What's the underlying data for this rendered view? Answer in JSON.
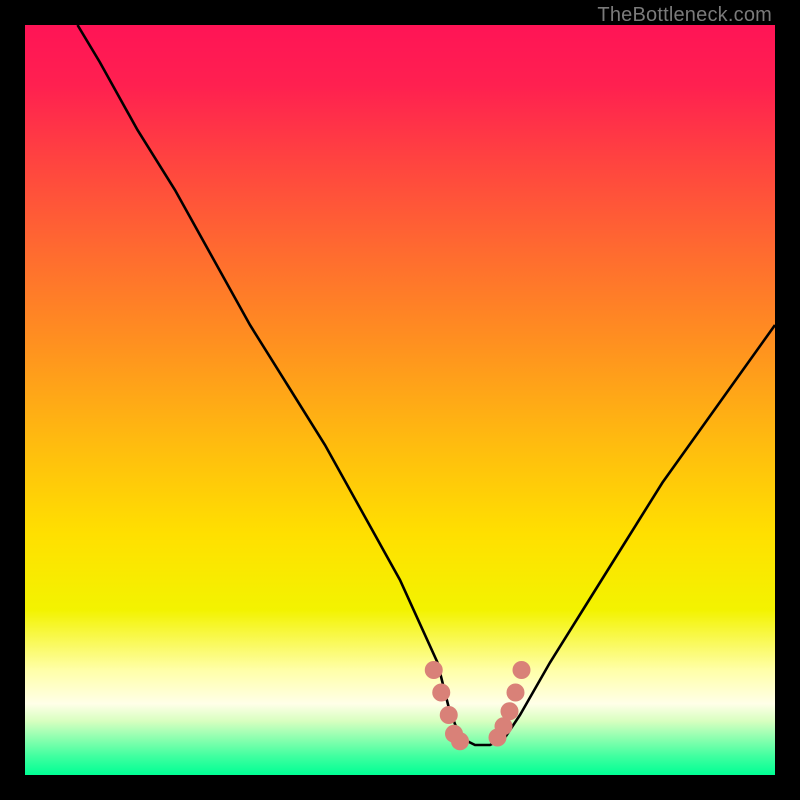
{
  "watermark": "TheBottleneck.com",
  "gradient": {
    "stops": [
      {
        "offset": 0.0,
        "color": "#ff1456"
      },
      {
        "offset": 0.08,
        "color": "#ff2050"
      },
      {
        "offset": 0.18,
        "color": "#ff4340"
      },
      {
        "offset": 0.3,
        "color": "#ff6a30"
      },
      {
        "offset": 0.42,
        "color": "#ff8f20"
      },
      {
        "offset": 0.55,
        "color": "#ffb910"
      },
      {
        "offset": 0.68,
        "color": "#ffe000"
      },
      {
        "offset": 0.78,
        "color": "#f3f300"
      },
      {
        "offset": 0.86,
        "color": "#ffffa8"
      },
      {
        "offset": 0.905,
        "color": "#ffffe8"
      },
      {
        "offset": 0.928,
        "color": "#d8ffc0"
      },
      {
        "offset": 0.95,
        "color": "#90ffb0"
      },
      {
        "offset": 0.975,
        "color": "#40ffa0"
      },
      {
        "offset": 1.0,
        "color": "#00ff94"
      }
    ]
  },
  "chart_data": {
    "type": "line",
    "title": "",
    "xlabel": "",
    "ylabel": "",
    "xlim": [
      0,
      100
    ],
    "ylim": [
      0,
      100
    ],
    "series": [
      {
        "name": "bottleneck-curve",
        "x": [
          7,
          10,
          15,
          20,
          25,
          30,
          35,
          40,
          45,
          50,
          55,
          56.5,
          58,
          60,
          62,
          64,
          66,
          70,
          75,
          80,
          85,
          90,
          95,
          100
        ],
        "y": [
          100,
          95,
          86,
          78,
          69,
          60,
          52,
          44,
          35,
          26,
          15,
          9,
          5,
          4,
          4,
          5,
          8,
          15,
          23,
          31,
          39,
          46,
          53,
          60
        ]
      }
    ],
    "highlight": {
      "name": "bottom-markers",
      "color": "#d98178",
      "points_x": [
        54.5,
        55.5,
        56.5,
        57.2,
        58.0,
        63.0,
        63.8,
        64.6,
        65.4,
        66.2
      ],
      "points_y": [
        14,
        11,
        8,
        5.5,
        4.5,
        5,
        6.5,
        8.5,
        11,
        14
      ]
    }
  }
}
